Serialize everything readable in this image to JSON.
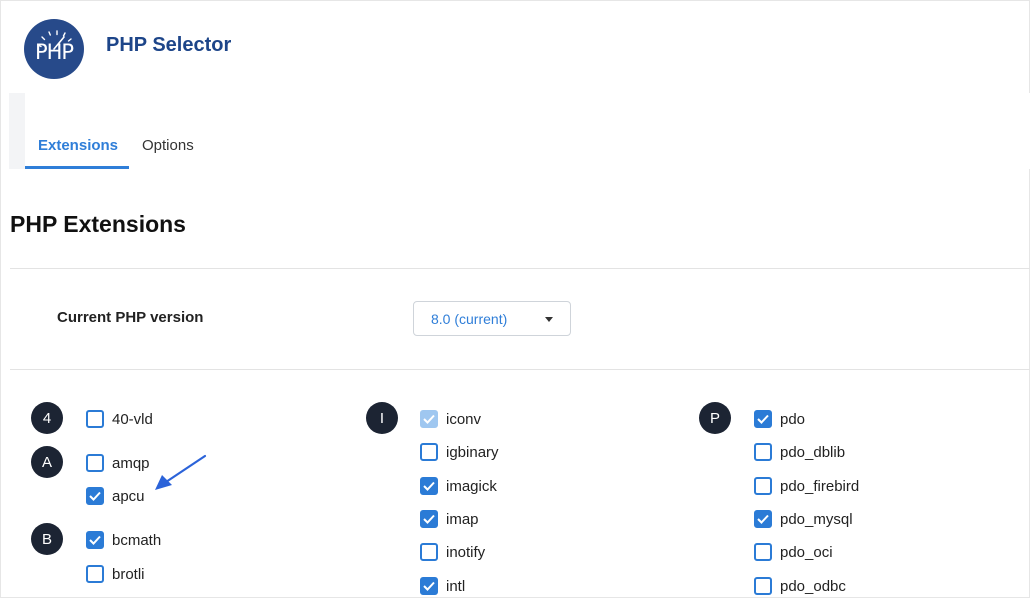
{
  "app": {
    "title": "PHP Selector",
    "logo_text": "PHP"
  },
  "tabs": [
    {
      "label": "Extensions",
      "active": true
    },
    {
      "label": "Options",
      "active": false
    }
  ],
  "section": {
    "title": "PHP Extensions"
  },
  "php_version": {
    "label": "Current PHP version",
    "selected": "8.0 (current)"
  },
  "extension_groups": [
    {
      "letter": "4",
      "items": [
        {
          "name": "40-vld",
          "checked": false
        }
      ]
    },
    {
      "letter": "A",
      "items": [
        {
          "name": "amqp",
          "checked": false
        },
        {
          "name": "apcu",
          "checked": true
        }
      ]
    },
    {
      "letter": "B",
      "items": [
        {
          "name": "bcmath",
          "checked": true
        },
        {
          "name": "brotli",
          "checked": false
        }
      ]
    },
    {
      "letter": "I",
      "items": [
        {
          "name": "iconv",
          "checked": true,
          "disabled": true
        },
        {
          "name": "igbinary",
          "checked": false
        },
        {
          "name": "imagick",
          "checked": true
        },
        {
          "name": "imap",
          "checked": true
        },
        {
          "name": "inotify",
          "checked": false
        },
        {
          "name": "intl",
          "checked": true
        }
      ]
    },
    {
      "letter": "P",
      "items": [
        {
          "name": "pdo",
          "checked": true
        },
        {
          "name": "pdo_dblib",
          "checked": false
        },
        {
          "name": "pdo_firebird",
          "checked": false
        },
        {
          "name": "pdo_mysql",
          "checked": true
        },
        {
          "name": "pdo_oci",
          "checked": false
        },
        {
          "name": "pdo_odbc",
          "checked": false
        }
      ]
    }
  ],
  "colors": {
    "brand": "#1d4589",
    "accent": "#2f7ed8",
    "checkbox": "#2b7bd6",
    "badge": "#1c2433"
  }
}
